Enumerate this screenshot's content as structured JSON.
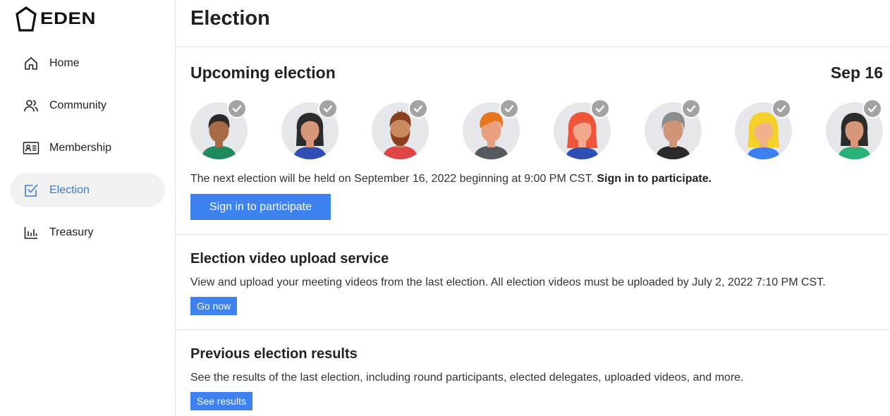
{
  "app": {
    "logo_text": "EDEN",
    "logo_icon": "pentagon-icon"
  },
  "sidebar": {
    "items": [
      {
        "label": "Home",
        "icon": "home-icon",
        "active": false
      },
      {
        "label": "Community",
        "icon": "people-icon",
        "active": false
      },
      {
        "label": "Membership",
        "icon": "id-card-icon",
        "active": false
      },
      {
        "label": "Election",
        "icon": "checkbox-icon",
        "active": true
      },
      {
        "label": "Treasury",
        "icon": "bar-chart-icon",
        "active": false
      }
    ]
  },
  "page": {
    "title": "Election"
  },
  "upcoming": {
    "title": "Upcoming election",
    "date": "Sep 16",
    "avatar_count": 8,
    "text": "The next election will be held on September 16, 2022 beginning at 9:00 PM CST.",
    "text_bold": "Sign in to participate.",
    "button_label": "Sign in to participate"
  },
  "video_upload": {
    "title": "Election video upload service",
    "text": "View and upload your meeting videos from the last election. All election videos must be uploaded by July 2, 2022 7:10 PM CST.",
    "button_label": "Go now"
  },
  "previous_results": {
    "title": "Previous election results",
    "text": "See the results of the last election, including round participants, elected delegates, uploaded videos, and more.",
    "button_label": "See results"
  },
  "colors": {
    "accent": "#3e82f0",
    "active_nav_text": "#3a7bd5",
    "active_nav_bg": "#f1f1f1",
    "check_badge": "#a3a3a3"
  }
}
